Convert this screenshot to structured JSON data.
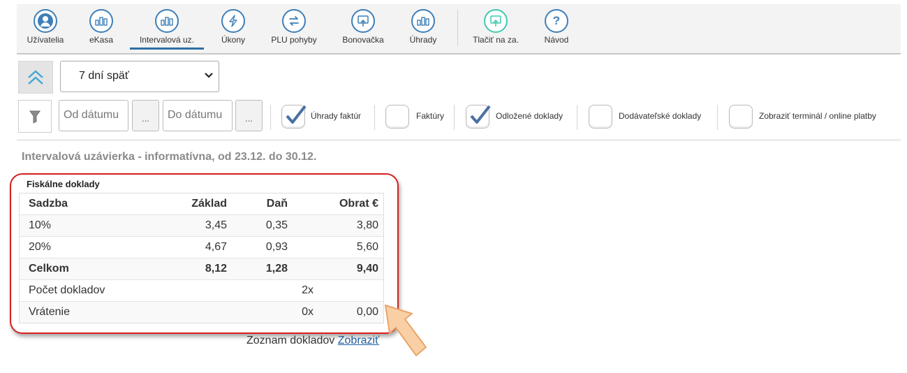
{
  "toolbar": {
    "items": [
      {
        "label": "Užívatelia",
        "icon": "user-icon"
      },
      {
        "label": "eKasa",
        "icon": "bar-chart-icon"
      },
      {
        "label": "Intervalová uz.",
        "icon": "bar-chart-icon",
        "active": true
      },
      {
        "label": "Úkony",
        "icon": "bolt-icon"
      },
      {
        "label": "PLU pohyby",
        "icon": "swap-arrows-icon"
      },
      {
        "label": "Bonovačka",
        "icon": "monitor-upload-icon"
      },
      {
        "label": "Úhrady",
        "icon": "bar-chart-icon"
      },
      {
        "label": "Tlačiť na za.",
        "icon": "monitor-upload-icon"
      },
      {
        "label": "Návod",
        "icon": "question-icon"
      }
    ]
  },
  "filters": {
    "period_value": "7 dní späť",
    "date_from_placeholder": "Od dátumu",
    "date_to_placeholder": "Do dátumu",
    "dots": "...",
    "checkboxes": [
      {
        "label": "Úhrady faktúr",
        "checked": true
      },
      {
        "label": "Faktúry",
        "checked": false
      },
      {
        "label": "Odložené doklady",
        "checked": true
      },
      {
        "label": "Dodávateľské doklady",
        "checked": false
      },
      {
        "label": "Zobraziť terminál / online platby",
        "checked": false
      }
    ]
  },
  "report": {
    "title": "Intervalová uzávierka - informatívna, od 23.12. do 30.12.",
    "section_title": "Fiskálne doklady",
    "headers": {
      "rate": "Sadzba",
      "base": "Základ",
      "tax": "Daň",
      "turnover": "Obrat €"
    },
    "rows": [
      {
        "rate": "10%",
        "base": "3,45",
        "tax": "0,35",
        "turnover": "3,80"
      },
      {
        "rate": "20%",
        "base": "4,67",
        "tax": "0,93",
        "turnover": "5,60"
      }
    ],
    "total": {
      "label": "Celkom",
      "base": "8,12",
      "tax": "1,28",
      "turnover": "9,40"
    },
    "doc_count": {
      "label": "Počet dokladov",
      "value": "2x"
    },
    "refunds": {
      "label": "Vrátenie",
      "value": "0x",
      "amount": "0,00"
    },
    "docs_list_label": "Zoznam dokladov",
    "docs_list_link": "Zobraziť"
  },
  "colors": {
    "accent": "#3d7fb8",
    "highlight_frame": "#d61f1f",
    "arrow": "#f9cfa6"
  }
}
